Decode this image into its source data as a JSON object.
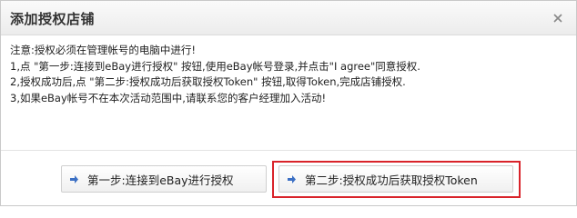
{
  "dialog": {
    "title": "添加授权店铺",
    "close_icon": "close-icon"
  },
  "instructions": {
    "lines": [
      "注意:授权必须在管理帐号的电脑中进行!",
      "1,点 \"第一步:连接到eBay进行授权\" 按钮,使用eBay帐号登录,并点击\"I agree\"同意授权.",
      "2,授权成功后,点 \"第二步:授权成功后获取授权Token\" 按钮,取得Token,完成店铺授权.",
      "3,如果eBay帐号不在本次活动范围中,请联系您的客户经理加入活动!"
    ]
  },
  "buttons": {
    "step1_label": "第一步:连接到eBay进行授权",
    "step2_label": "第二步:授权成功后获取授权Token",
    "icon": "arrow-right-icon"
  },
  "colors": {
    "highlight_border": "#d9232a",
    "arrow_icon": "#3b6fc4"
  }
}
